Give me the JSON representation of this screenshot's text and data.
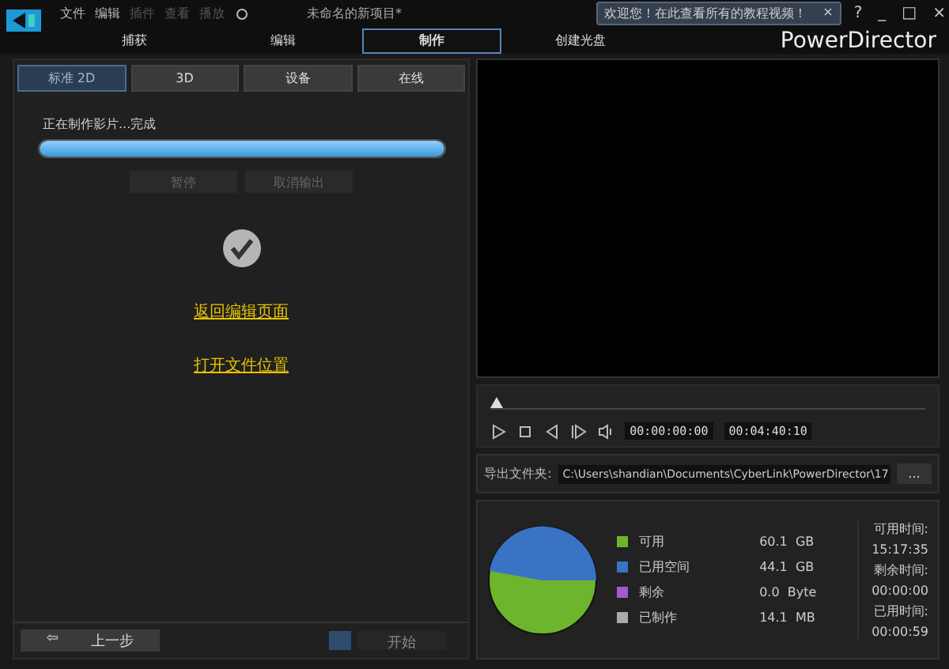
{
  "menu": [
    {
      "label": "文件",
      "disabled": false
    },
    {
      "label": "编辑",
      "disabled": false
    },
    {
      "label": "插件",
      "disabled": true
    },
    {
      "label": "查看",
      "disabled": true
    },
    {
      "label": "播放",
      "disabled": true
    }
  ],
  "window": {
    "title": "未命名的新项目*",
    "brand": "PowerDirector",
    "controls": [
      "?",
      "_",
      "□",
      "×"
    ]
  },
  "tooltip": {
    "text": "欢迎您！在此查看所有的教程视频！",
    "close": "×"
  },
  "main_tabs": [
    {
      "label": "捕获",
      "selected": false
    },
    {
      "label": "编辑",
      "selected": false
    },
    {
      "label": "制作",
      "selected": true
    },
    {
      "label": "创建光盘",
      "selected": false
    }
  ],
  "sub_tabs": [
    {
      "label": "标准 2D",
      "selected": true
    },
    {
      "label": "3D",
      "selected": false
    },
    {
      "label": "设备",
      "selected": false
    },
    {
      "label": "在线",
      "selected": false
    }
  ],
  "progress": {
    "label": "正在制作影片...完成",
    "level": 1.0
  },
  "progress_buttons": [
    {
      "label": "暂停",
      "disabled": true
    },
    {
      "label": "取消输出",
      "disabled": true
    }
  ],
  "links": [
    "返回编辑页面",
    "打开文件位置"
  ],
  "bottom": {
    "back": "上一步",
    "back_arrow": "⇦",
    "start": "开始",
    "start_disabled": true
  },
  "player": {
    "position": "00:00:00:00",
    "duration": "00:04:40:10"
  },
  "export": {
    "label": "导出文件夹:",
    "path": "C:\\Users\\shandian\\Documents\\CyberLink\\PowerDirector\\17",
    "browse": "..."
  },
  "storage": {
    "legend": [
      {
        "label": "可用",
        "value": "60.1  GB",
        "color": "#6cb52c"
      },
      {
        "label": "已用空间",
        "value": "44.1  GB",
        "color": "#3a73c4"
      },
      {
        "label": "剩余",
        "value": "0.0  Byte",
        "color": "#a15bd0"
      },
      {
        "label": "已制作",
        "value": "14.1  MB",
        "color": "#aaaaaa"
      }
    ],
    "times": [
      {
        "label": "可用时间:",
        "value": "15:17:35"
      },
      {
        "label": "剩余时间:",
        "value": "00:00:00"
      },
      {
        "label": "已用时间:",
        "value": "00:00:59"
      }
    ]
  }
}
